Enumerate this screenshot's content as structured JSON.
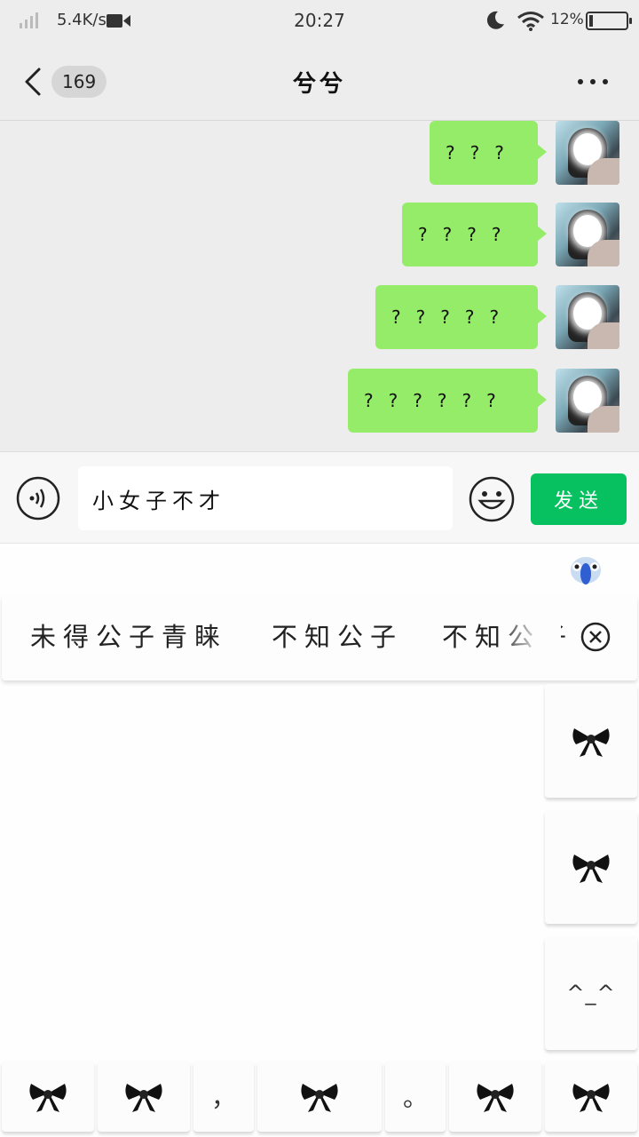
{
  "status_bar": {
    "network_speed": "5.4K/s",
    "time": "20:27",
    "battery_percent": "12%",
    "battery_level": 0.12,
    "icons": [
      "signal-icon",
      "video-camera-icon",
      "moon-icon",
      "wifi-icon",
      "battery-icon"
    ]
  },
  "header": {
    "unread_count": "169",
    "title": "兮兮",
    "icons": [
      "back-chevron-icon",
      "more-dots-icon"
    ]
  },
  "messages": [
    {
      "sender": "me",
      "text": "???"
    },
    {
      "sender": "me",
      "text": "????"
    },
    {
      "sender": "me",
      "text": "?????"
    },
    {
      "sender": "me",
      "text": "??????"
    }
  ],
  "composer": {
    "input_value": "小女子不才",
    "send_label": "发送",
    "icons": [
      "voice-icon",
      "emoji-icon"
    ]
  },
  "keyboard": {
    "candidates": [
      "未得公子青睐",
      "不知公子",
      "不知公子"
    ],
    "side_keys": [
      "bow",
      "bow",
      "^_^"
    ],
    "bottom_keys": [
      "bow",
      "bow",
      "，",
      "bow",
      "。",
      "bow",
      "bow"
    ],
    "icons": [
      "keyboard-logo-icon",
      "clear-candidates-icon",
      "bow-icon"
    ]
  },
  "colors": {
    "bubble_green": "#95ec69",
    "send_green": "#07c160",
    "background": "#ededed"
  }
}
